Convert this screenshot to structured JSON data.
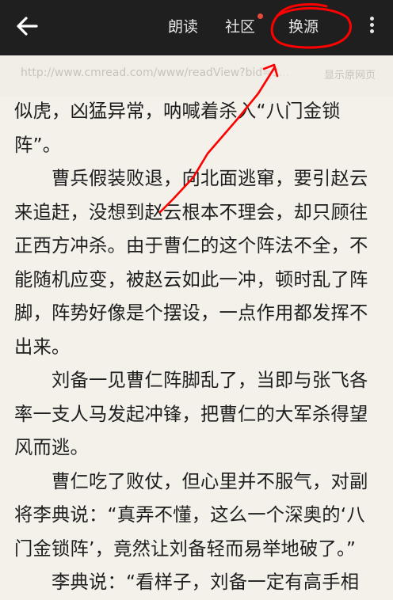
{
  "toolbar": {
    "read_aloud": "朗读",
    "community": "社区",
    "change_source": "换源",
    "accent_dot_color": "#e64a3a"
  },
  "urlbar": {
    "url": "http://www.cmread.com/www/readView?bid=3...",
    "show_source": "显示原网页"
  },
  "article": {
    "paragraphs": [
      "似虎，凶猛异常，呐喊着杀入“八门金锁阵”。",
      "曹兵假装败退，向北面逃窜，要引赵云来追赶，没想到赵云根本不理会，却只顾往正西方冲杀。由于曹仁的这个阵法不全，不能随机应变，被赵云如此一冲，顿时乱了阵脚，阵势好像是个摆设，一点作用都发挥不出来。",
      "刘备一见曹仁阵脚乱了，当即与张飞各率一支人马发起冲锋，把曹仁的大军杀得望风而逃。",
      "曹仁吃了败仗，但心里并不服气，对副将李典说：“真弄不懂，这么一个深奥的‘八门金锁阵’，竟然让刘备轻而易举地破了。”",
      "李典说：“看样子，刘备一定有高手相"
    ]
  },
  "annotation": {
    "color": "#ff0000"
  }
}
